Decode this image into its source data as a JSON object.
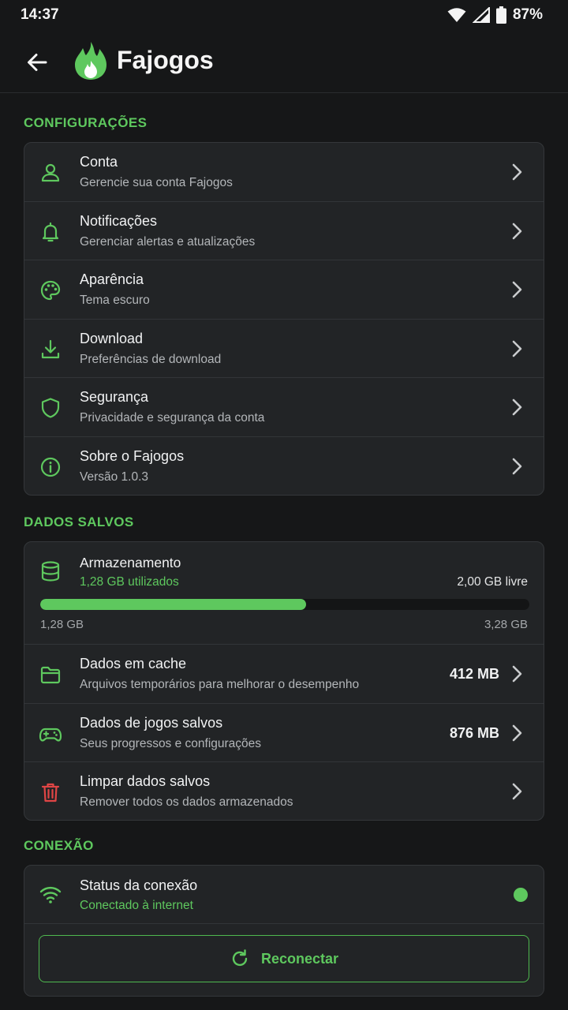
{
  "status_bar": {
    "time": "14:37",
    "battery": "87%"
  },
  "app": {
    "title": "Fajogos",
    "accent": "#5ec85e",
    "danger": "#e04545"
  },
  "sections": {
    "settings": {
      "title": "CONFIGURAÇÕES",
      "items": [
        {
          "icon": "person-icon",
          "title": "Conta",
          "subtitle": "Gerencie sua conta Fajogos"
        },
        {
          "icon": "bell-icon",
          "title": "Notificações",
          "subtitle": "Gerenciar alertas e atualizações"
        },
        {
          "icon": "palette-icon",
          "title": "Aparência",
          "subtitle": "Tema escuro"
        },
        {
          "icon": "download-icon",
          "title": "Download",
          "subtitle": "Preferências de download"
        },
        {
          "icon": "shield-icon",
          "title": "Segurança",
          "subtitle": "Privacidade e segurança da conta"
        },
        {
          "icon": "info-icon",
          "title": "Sobre o Fajogos",
          "subtitle": "Versão 1.0.3"
        }
      ]
    },
    "saved_data": {
      "title": "DADOS SALVOS",
      "storage": {
        "title": "Armazenamento",
        "used_label": "1,28 GB utilizados",
        "free_label": "2,00 GB livre",
        "min_label": "1,28 GB",
        "max_label": "3,28 GB",
        "used_fraction": 0.543
      },
      "items": [
        {
          "icon": "folder-icon",
          "title": "Dados em cache",
          "subtitle": "Arquivos temporários para melhorar o desempenho",
          "value": "412 MB"
        },
        {
          "icon": "gamepad-icon",
          "title": "Dados de jogos salvos",
          "subtitle": "Seus progressos e configurações",
          "value": "876 MB"
        },
        {
          "icon": "trash-icon",
          "title": "Limpar dados salvos",
          "subtitle": "Remover todos os dados armazenados",
          "value": ""
        }
      ]
    },
    "connection": {
      "title": "CONEXÃO",
      "status_title": "Status da conexão",
      "status_text": "Conectado à internet",
      "button_label": "Reconectar"
    }
  }
}
